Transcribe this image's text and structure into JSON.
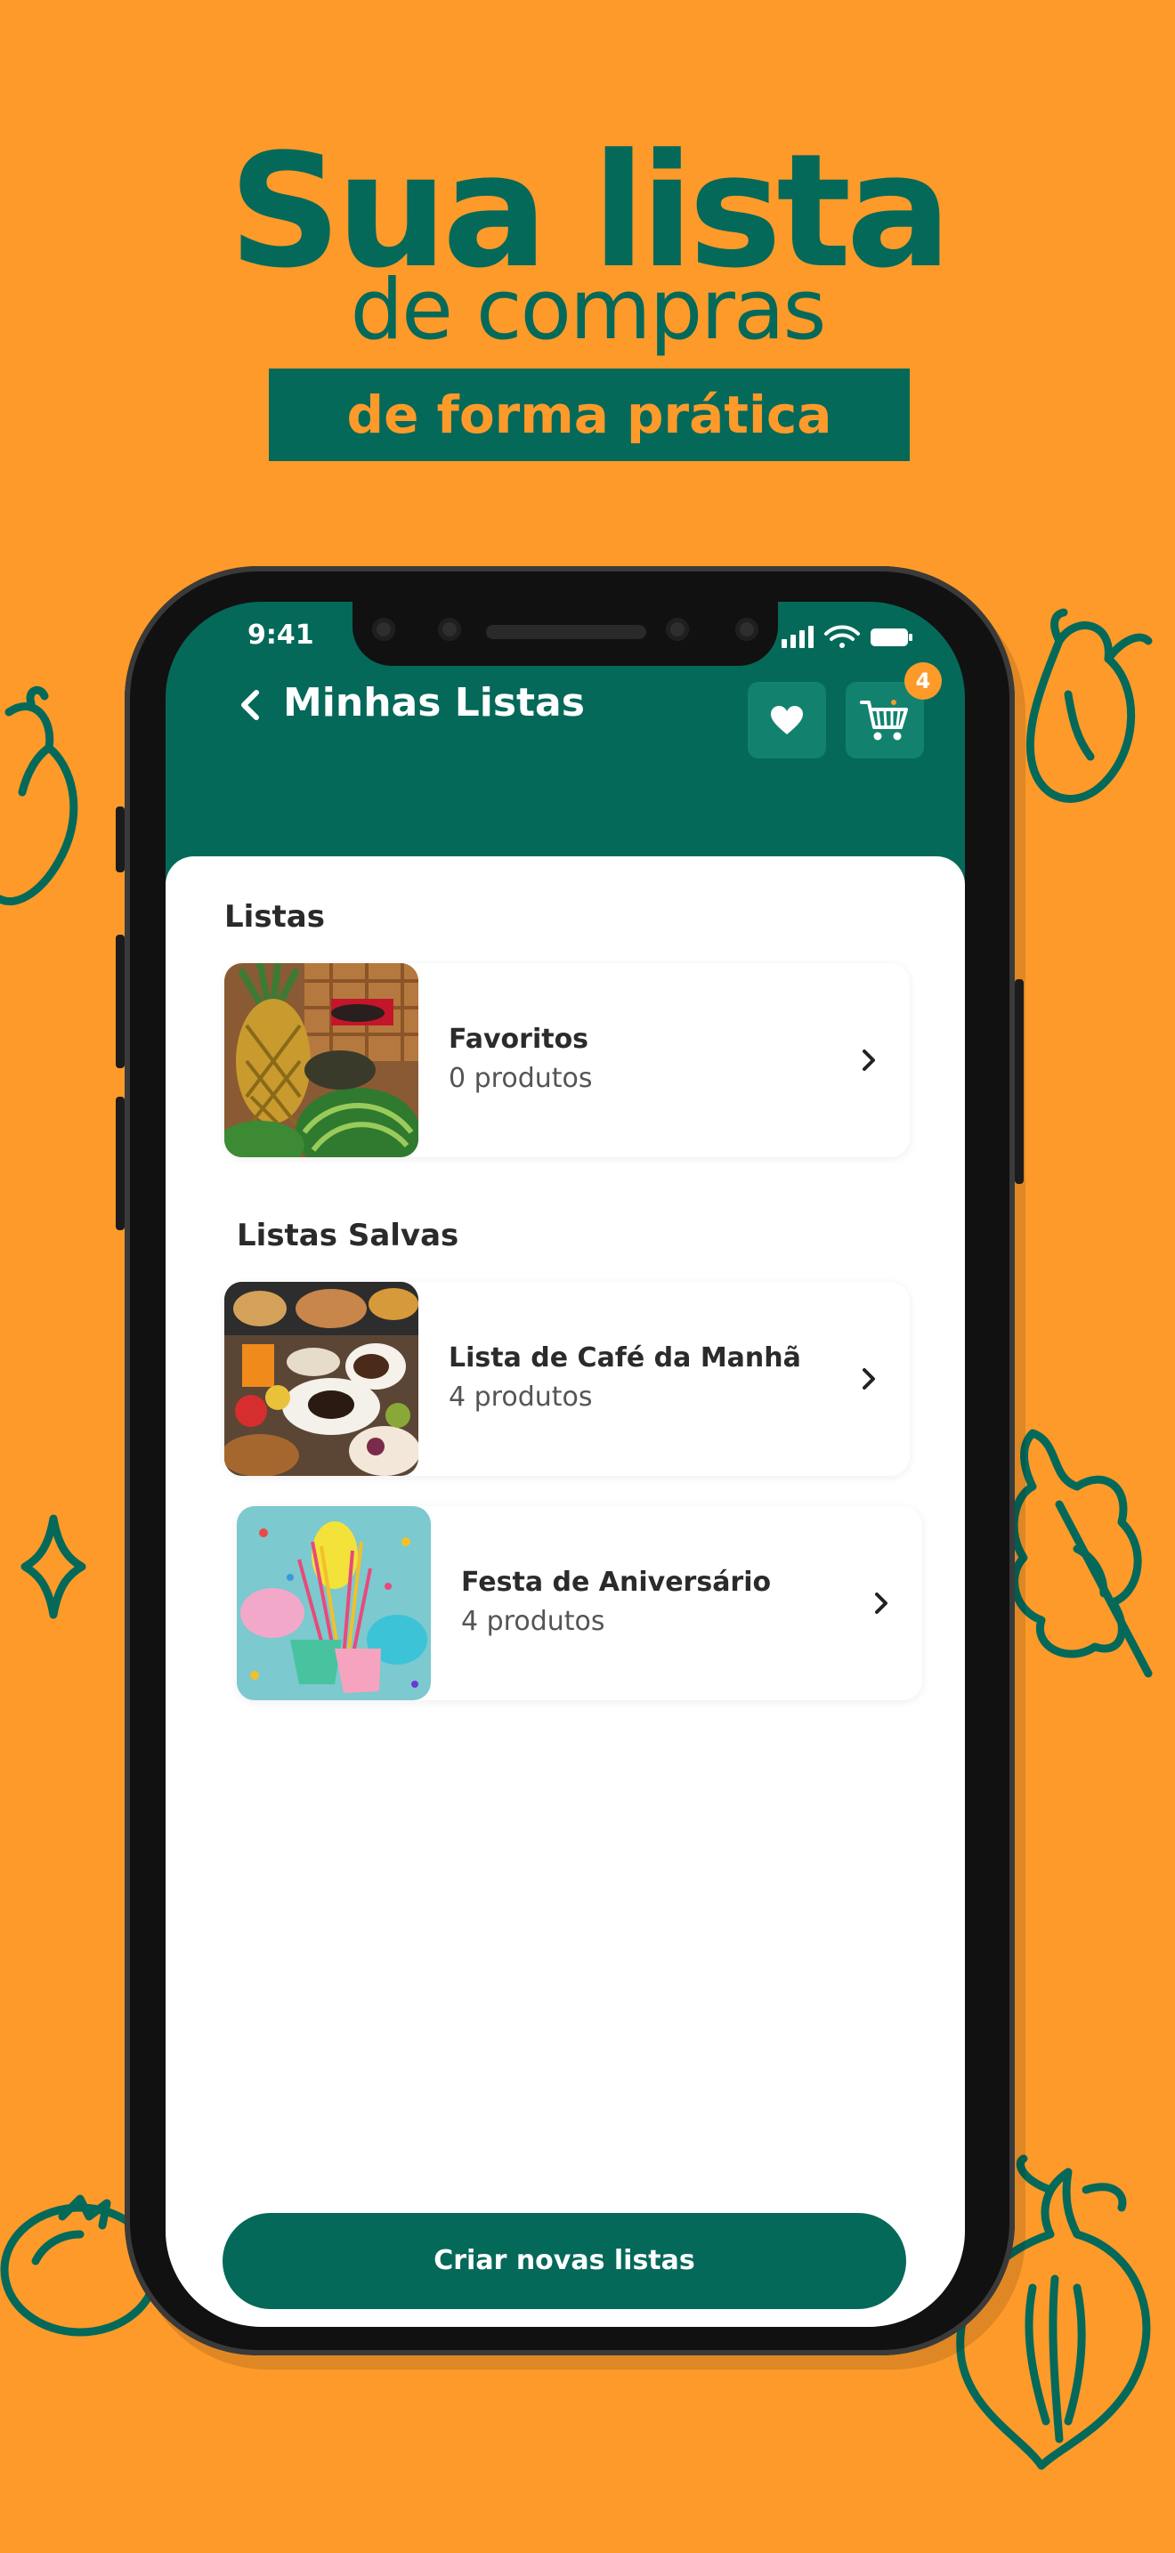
{
  "headline": {
    "line1": "Sua lista",
    "line2": "de compras",
    "band": "de forma prática"
  },
  "colors": {
    "background": "#FD9A2A",
    "brand": "#05695A",
    "accent": "#FD9A2A"
  },
  "status_bar": {
    "time": "9:41",
    "icons": [
      "signal-icon",
      "wifi-icon",
      "battery-icon"
    ]
  },
  "header": {
    "back_icon": "chevron-left-icon",
    "title": "Minhas Listas",
    "favorite_icon": "heart-icon",
    "cart_icon": "cart-icon",
    "cart_badge": "4"
  },
  "sections": {
    "lists_label": "Listas",
    "saved_label": "Listas Salvas"
  },
  "lists": [
    {
      "title": "Favoritos",
      "count": "0 produtos",
      "thumb": "fruits-market-photo"
    }
  ],
  "saved_lists": [
    {
      "title": "Lista de Café da Manhã",
      "count": "4 produtos",
      "thumb": "breakfast-photo"
    },
    {
      "title": "Festa de Aniversário",
      "count": "4 produtos",
      "thumb": "party-photo"
    }
  ],
  "cta": {
    "label": "Criar novas listas"
  }
}
